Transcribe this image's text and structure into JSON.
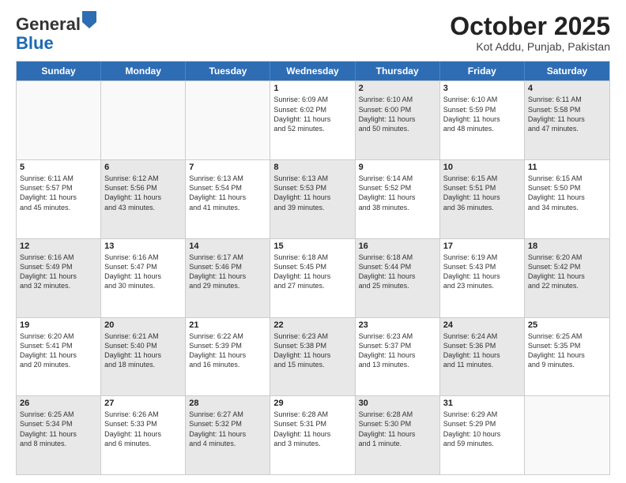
{
  "header": {
    "logo": {
      "line1": "General",
      "line2": "Blue"
    },
    "title": "October 2025",
    "subtitle": "Kot Addu, Punjab, Pakistan"
  },
  "weekdays": [
    "Sunday",
    "Monday",
    "Tuesday",
    "Wednesday",
    "Thursday",
    "Friday",
    "Saturday"
  ],
  "rows": [
    [
      {
        "day": "",
        "info": "",
        "shaded": false,
        "empty": true
      },
      {
        "day": "",
        "info": "",
        "shaded": false,
        "empty": true
      },
      {
        "day": "",
        "info": "",
        "shaded": false,
        "empty": true
      },
      {
        "day": "1",
        "info": "Sunrise: 6:09 AM\nSunset: 6:02 PM\nDaylight: 11 hours\nand 52 minutes.",
        "shaded": false,
        "empty": false
      },
      {
        "day": "2",
        "info": "Sunrise: 6:10 AM\nSunset: 6:00 PM\nDaylight: 11 hours\nand 50 minutes.",
        "shaded": true,
        "empty": false
      },
      {
        "day": "3",
        "info": "Sunrise: 6:10 AM\nSunset: 5:59 PM\nDaylight: 11 hours\nand 48 minutes.",
        "shaded": false,
        "empty": false
      },
      {
        "day": "4",
        "info": "Sunrise: 6:11 AM\nSunset: 5:58 PM\nDaylight: 11 hours\nand 47 minutes.",
        "shaded": true,
        "empty": false
      }
    ],
    [
      {
        "day": "5",
        "info": "Sunrise: 6:11 AM\nSunset: 5:57 PM\nDaylight: 11 hours\nand 45 minutes.",
        "shaded": false,
        "empty": false
      },
      {
        "day": "6",
        "info": "Sunrise: 6:12 AM\nSunset: 5:56 PM\nDaylight: 11 hours\nand 43 minutes.",
        "shaded": true,
        "empty": false
      },
      {
        "day": "7",
        "info": "Sunrise: 6:13 AM\nSunset: 5:54 PM\nDaylight: 11 hours\nand 41 minutes.",
        "shaded": false,
        "empty": false
      },
      {
        "day": "8",
        "info": "Sunrise: 6:13 AM\nSunset: 5:53 PM\nDaylight: 11 hours\nand 39 minutes.",
        "shaded": true,
        "empty": false
      },
      {
        "day": "9",
        "info": "Sunrise: 6:14 AM\nSunset: 5:52 PM\nDaylight: 11 hours\nand 38 minutes.",
        "shaded": false,
        "empty": false
      },
      {
        "day": "10",
        "info": "Sunrise: 6:15 AM\nSunset: 5:51 PM\nDaylight: 11 hours\nand 36 minutes.",
        "shaded": true,
        "empty": false
      },
      {
        "day": "11",
        "info": "Sunrise: 6:15 AM\nSunset: 5:50 PM\nDaylight: 11 hours\nand 34 minutes.",
        "shaded": false,
        "empty": false
      }
    ],
    [
      {
        "day": "12",
        "info": "Sunrise: 6:16 AM\nSunset: 5:49 PM\nDaylight: 11 hours\nand 32 minutes.",
        "shaded": true,
        "empty": false
      },
      {
        "day": "13",
        "info": "Sunrise: 6:16 AM\nSunset: 5:47 PM\nDaylight: 11 hours\nand 30 minutes.",
        "shaded": false,
        "empty": false
      },
      {
        "day": "14",
        "info": "Sunrise: 6:17 AM\nSunset: 5:46 PM\nDaylight: 11 hours\nand 29 minutes.",
        "shaded": true,
        "empty": false
      },
      {
        "day": "15",
        "info": "Sunrise: 6:18 AM\nSunset: 5:45 PM\nDaylight: 11 hours\nand 27 minutes.",
        "shaded": false,
        "empty": false
      },
      {
        "day": "16",
        "info": "Sunrise: 6:18 AM\nSunset: 5:44 PM\nDaylight: 11 hours\nand 25 minutes.",
        "shaded": true,
        "empty": false
      },
      {
        "day": "17",
        "info": "Sunrise: 6:19 AM\nSunset: 5:43 PM\nDaylight: 11 hours\nand 23 minutes.",
        "shaded": false,
        "empty": false
      },
      {
        "day": "18",
        "info": "Sunrise: 6:20 AM\nSunset: 5:42 PM\nDaylight: 11 hours\nand 22 minutes.",
        "shaded": true,
        "empty": false
      }
    ],
    [
      {
        "day": "19",
        "info": "Sunrise: 6:20 AM\nSunset: 5:41 PM\nDaylight: 11 hours\nand 20 minutes.",
        "shaded": false,
        "empty": false
      },
      {
        "day": "20",
        "info": "Sunrise: 6:21 AM\nSunset: 5:40 PM\nDaylight: 11 hours\nand 18 minutes.",
        "shaded": true,
        "empty": false
      },
      {
        "day": "21",
        "info": "Sunrise: 6:22 AM\nSunset: 5:39 PM\nDaylight: 11 hours\nand 16 minutes.",
        "shaded": false,
        "empty": false
      },
      {
        "day": "22",
        "info": "Sunrise: 6:23 AM\nSunset: 5:38 PM\nDaylight: 11 hours\nand 15 minutes.",
        "shaded": true,
        "empty": false
      },
      {
        "day": "23",
        "info": "Sunrise: 6:23 AM\nSunset: 5:37 PM\nDaylight: 11 hours\nand 13 minutes.",
        "shaded": false,
        "empty": false
      },
      {
        "day": "24",
        "info": "Sunrise: 6:24 AM\nSunset: 5:36 PM\nDaylight: 11 hours\nand 11 minutes.",
        "shaded": true,
        "empty": false
      },
      {
        "day": "25",
        "info": "Sunrise: 6:25 AM\nSunset: 5:35 PM\nDaylight: 11 hours\nand 9 minutes.",
        "shaded": false,
        "empty": false
      }
    ],
    [
      {
        "day": "26",
        "info": "Sunrise: 6:25 AM\nSunset: 5:34 PM\nDaylight: 11 hours\nand 8 minutes.",
        "shaded": true,
        "empty": false
      },
      {
        "day": "27",
        "info": "Sunrise: 6:26 AM\nSunset: 5:33 PM\nDaylight: 11 hours\nand 6 minutes.",
        "shaded": false,
        "empty": false
      },
      {
        "day": "28",
        "info": "Sunrise: 6:27 AM\nSunset: 5:32 PM\nDaylight: 11 hours\nand 4 minutes.",
        "shaded": true,
        "empty": false
      },
      {
        "day": "29",
        "info": "Sunrise: 6:28 AM\nSunset: 5:31 PM\nDaylight: 11 hours\nand 3 minutes.",
        "shaded": false,
        "empty": false
      },
      {
        "day": "30",
        "info": "Sunrise: 6:28 AM\nSunset: 5:30 PM\nDaylight: 11 hours\nand 1 minute.",
        "shaded": true,
        "empty": false
      },
      {
        "day": "31",
        "info": "Sunrise: 6:29 AM\nSunset: 5:29 PM\nDaylight: 10 hours\nand 59 minutes.",
        "shaded": false,
        "empty": false
      },
      {
        "day": "",
        "info": "",
        "shaded": true,
        "empty": true
      }
    ]
  ]
}
